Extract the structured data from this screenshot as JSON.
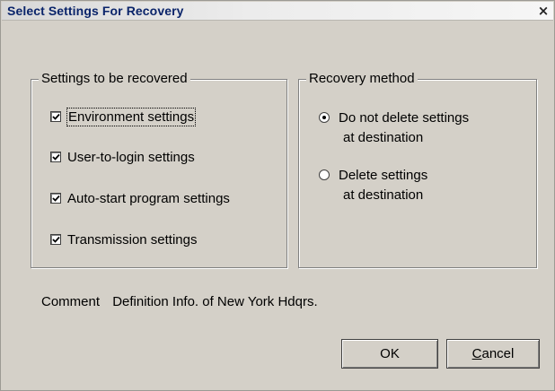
{
  "window": {
    "title": "Select Settings For Recovery",
    "close_glyph": "×"
  },
  "settings_group": {
    "legend": "Settings to  be recovered",
    "items": [
      {
        "label": "Environment settings",
        "checked": true,
        "focused": true
      },
      {
        "label": "User-to-login settings",
        "checked": true
      },
      {
        "label": "Auto-start program settings",
        "checked": true
      },
      {
        "label": "Transmission settings",
        "checked": true
      }
    ]
  },
  "method_group": {
    "legend": "Recovery method",
    "options": [
      {
        "line1": "Do not delete settings",
        "line2": "at destination",
        "selected": true
      },
      {
        "line1": "Delete settings",
        "line2": "at destination",
        "selected": false
      }
    ]
  },
  "comment": {
    "label": "Comment",
    "value": "Definition Info. of New York Hdqrs."
  },
  "buttons": {
    "ok": "OK",
    "cancel": "Cancel"
  }
}
